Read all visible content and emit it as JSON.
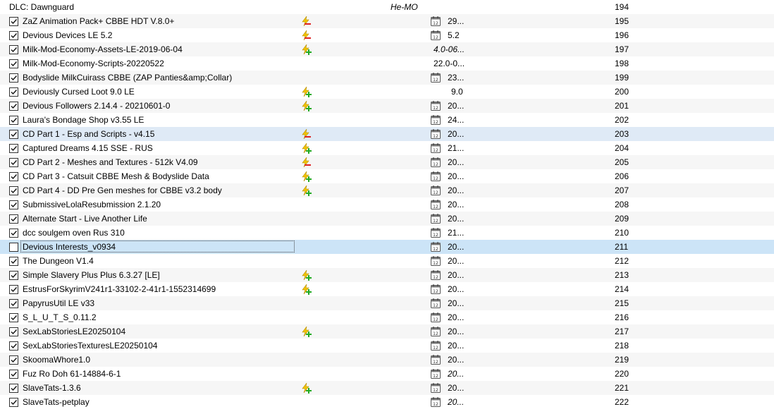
{
  "separator": {
    "name": "DLC: Dawnguard",
    "label": "He-MO",
    "priority": "194"
  },
  "colors": {
    "selected": "#cce4f7",
    "hover": "#dfeaf6",
    "alt": "#f6f6f6"
  },
  "rows": [
    {
      "name": "ZaZ Animation Pack+ CBBE HDT V.8.0+",
      "checked": true,
      "flag": "red",
      "cal": true,
      "version": "29...",
      "priority": "195"
    },
    {
      "name": "Devious Devices LE 5.2",
      "checked": true,
      "flag": "red",
      "cal": true,
      "version": "5.2",
      "priority": "196"
    },
    {
      "name": "Milk-Mod-Economy-Assets-LE-2019-06-04",
      "checked": true,
      "flag": "green",
      "cal": false,
      "version": "4.0-06...",
      "version_italic": true,
      "priority": "197"
    },
    {
      "name": "Milk-Mod-Economy-Scripts-20220522",
      "checked": true,
      "flag": "",
      "cal": false,
      "version": "22.0-0...",
      "priority": "198"
    },
    {
      "name": "Bodyslide MilkCuirass CBBE (ZAP Panties&amp;Collar)",
      "checked": true,
      "flag": "",
      "cal": true,
      "version": "23...",
      "priority": "199"
    },
    {
      "name": "Deviously Cursed Loot 9.0 LE",
      "checked": true,
      "flag": "green",
      "cal": false,
      "version": "9.0",
      "priority": "200"
    },
    {
      "name": "Devious Followers 2.14.4 - 20210601-0",
      "checked": true,
      "flag": "green",
      "cal": true,
      "version": "20...",
      "priority": "201"
    },
    {
      "name": "Laura's Bondage Shop v3.55 LE",
      "checked": true,
      "flag": "",
      "cal": true,
      "version": "24...",
      "priority": "202"
    },
    {
      "name": "CD Part 1 - Esp and Scripts - v4.15",
      "checked": true,
      "flag": "red",
      "cal": true,
      "version": "20...",
      "priority": "203",
      "state": "hi"
    },
    {
      "name": "Captured Dreams 4.15 SSE - RUS",
      "checked": true,
      "flag": "green",
      "cal": true,
      "version": "21...",
      "priority": "204"
    },
    {
      "name": "CD Part 2 - Meshes and Textures - 512k V4.09",
      "checked": true,
      "flag": "red",
      "cal": true,
      "version": "20...",
      "priority": "205"
    },
    {
      "name": "CD Part 3 - Catsuit CBBE Mesh & Bodyslide Data",
      "checked": true,
      "flag": "green",
      "cal": true,
      "version": "20...",
      "priority": "206"
    },
    {
      "name": "CD Part 4 - DD Pre Gen meshes for CBBE v3.2 body",
      "checked": true,
      "flag": "green",
      "cal": true,
      "version": "20...",
      "priority": "207"
    },
    {
      "name": "SubmissiveLolaResubmission 2.1.20",
      "checked": true,
      "flag": "",
      "cal": true,
      "version": "20...",
      "priority": "208"
    },
    {
      "name": "Alternate Start - Live Another Life",
      "checked": true,
      "flag": "",
      "cal": true,
      "version": "20...",
      "priority": "209"
    },
    {
      "name": "dcc soulgem oven Rus 310",
      "checked": true,
      "flag": "",
      "cal": true,
      "version": "21...",
      "priority": "210"
    },
    {
      "name": "Devious Interests_v0934",
      "checked": false,
      "flag": "",
      "cal": true,
      "version": "20...",
      "priority": "211",
      "state": "sel"
    },
    {
      "name": "The Dungeon V1.4",
      "checked": true,
      "flag": "",
      "cal": true,
      "version": "20...",
      "priority": "212"
    },
    {
      "name": "Simple Slavery Plus Plus 6.3.27 [LE]",
      "checked": true,
      "flag": "green",
      "cal": true,
      "version": "20...",
      "priority": "213"
    },
    {
      "name": "EstrusForSkyrimV241r1-33102-2-41r1-1552314699",
      "checked": true,
      "flag": "green",
      "cal": true,
      "version": "20...",
      "priority": "214"
    },
    {
      "name": "PapyrusUtil LE v33",
      "checked": true,
      "flag": "",
      "cal": true,
      "version": "20...",
      "priority": "215"
    },
    {
      "name": "S_L_U_T_S_0.11.2",
      "checked": true,
      "flag": "",
      "cal": true,
      "version": "20...",
      "priority": "216"
    },
    {
      "name": "SexLabStoriesLE20250104",
      "checked": true,
      "flag": "green",
      "cal": true,
      "version": "20...",
      "priority": "217"
    },
    {
      "name": "SexLabStoriesTexturesLE20250104",
      "checked": true,
      "flag": "",
      "cal": true,
      "version": "20...",
      "priority": "218"
    },
    {
      "name": "SkoomaWhore1.0",
      "checked": true,
      "flag": "",
      "cal": true,
      "version": "20...",
      "priority": "219"
    },
    {
      "name": "Fuz Ro Doh 61-14884-6-1",
      "checked": true,
      "flag": "",
      "cal": true,
      "version": "20...",
      "version_italic": true,
      "priority": "220"
    },
    {
      "name": "SlaveTats-1.3.6",
      "checked": true,
      "flag": "green",
      "cal": true,
      "version": "20...",
      "priority": "221"
    },
    {
      "name": "SlaveTats-petplay",
      "checked": true,
      "flag": "",
      "cal": true,
      "version": "20...",
      "version_italic": true,
      "priority": "222"
    }
  ]
}
